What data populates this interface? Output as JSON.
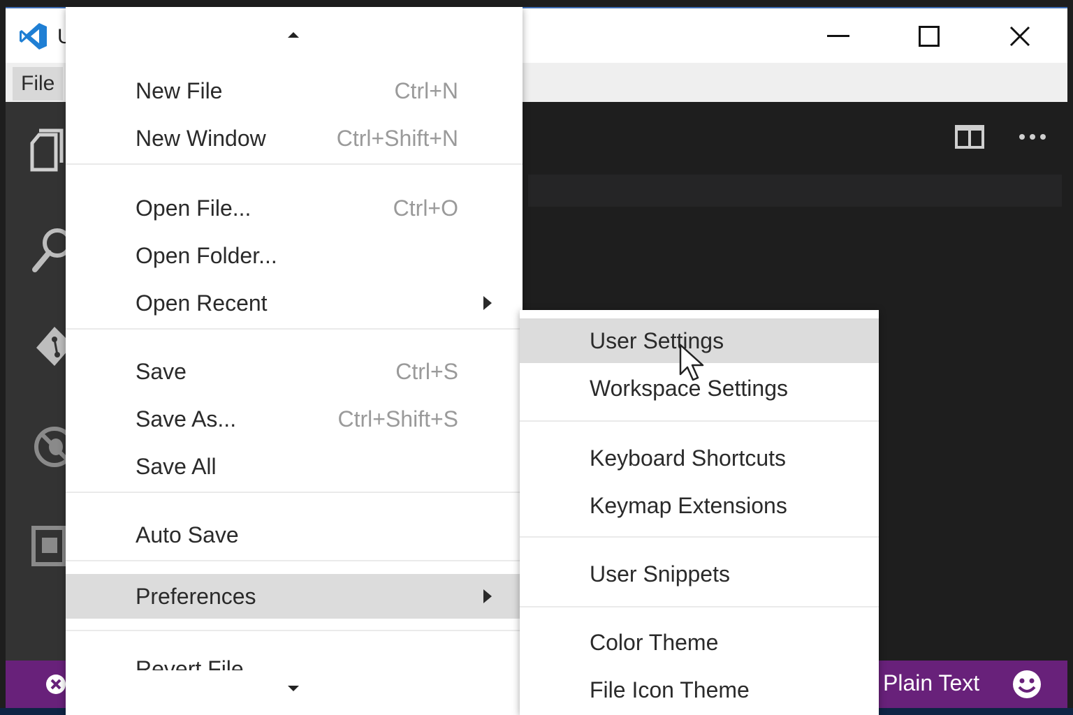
{
  "window": {
    "title_fragment": "U",
    "controls": [
      "minimize",
      "maximize",
      "close"
    ]
  },
  "menubar": {
    "file_label": "File"
  },
  "activity_bar": {
    "icons": [
      "explorer-icon",
      "search-icon",
      "git-icon",
      "debug-icon",
      "extensions-icon"
    ]
  },
  "editor": {
    "actions": [
      "split-editor-icon",
      "more-actions-icon"
    ]
  },
  "file_menu": {
    "items": [
      {
        "label": "New File",
        "shortcut": "Ctrl+N"
      },
      {
        "label": "New Window",
        "shortcut": "Ctrl+Shift+N"
      },
      {
        "label": "Open File...",
        "shortcut": "Ctrl+O"
      },
      {
        "label": "Open Folder...",
        "shortcut": ""
      },
      {
        "label": "Open Recent",
        "shortcut": ""
      },
      {
        "label": "Save",
        "shortcut": "Ctrl+S"
      },
      {
        "label": "Save As...",
        "shortcut": "Ctrl+Shift+S"
      },
      {
        "label": "Save All",
        "shortcut": ""
      },
      {
        "label": "Auto Save",
        "shortcut": ""
      },
      {
        "label": "Preferences",
        "shortcut": ""
      },
      {
        "label": "Revert File",
        "shortcut": ""
      }
    ]
  },
  "preferences_submenu": {
    "items": [
      {
        "label": "User Settings"
      },
      {
        "label": "Workspace Settings"
      },
      {
        "label": "Keyboard Shortcuts"
      },
      {
        "label": "Keymap Extensions"
      },
      {
        "label": "User Snippets"
      },
      {
        "label": "Color Theme"
      },
      {
        "label": "File Icon Theme"
      }
    ]
  },
  "statusbar": {
    "language": "Plain Text"
  },
  "colors": {
    "statusbar": "#68217a",
    "activitybar": "#333333",
    "editor": "#1e1e1e",
    "menu_highlight": "#dcdcdc",
    "logo": "#1f7fd4"
  }
}
